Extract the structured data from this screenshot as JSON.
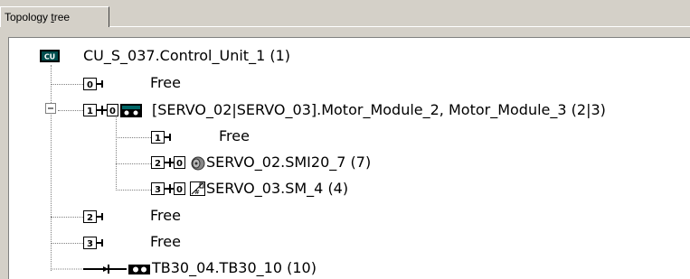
{
  "tab": {
    "label_pre": "Topology ",
    "label_ul": "t",
    "label_post": "ree"
  },
  "tree": {
    "root": {
      "badge": "CU",
      "label": "CU_S_037.Control_Unit_1 (1)"
    },
    "port0": {
      "num": "0",
      "label": "Free"
    },
    "motor": {
      "num": "1",
      "sub": "0",
      "label": "[SERVO_02|SERVO_03].Motor_Module_2, Motor_Module_3 (2|3)"
    },
    "m_port1": {
      "num": "1",
      "label": "Free"
    },
    "m_port2": {
      "num": "2",
      "sub": "0",
      "label": "SERVO_02.SMI20_7 (7)"
    },
    "m_port3": {
      "num": "3",
      "sub": "0",
      "label": "SERVO_03.SM_4 (4)"
    },
    "port2": {
      "num": "2",
      "label": "Free"
    },
    "port3": {
      "num": "3",
      "label": "Free"
    },
    "tb": {
      "label": "TB30_04.TB30_10 (10)"
    }
  },
  "colors": {
    "cu_icon": "#004d4d",
    "motor_icon": "#006666",
    "tree_lines": "#808080"
  }
}
